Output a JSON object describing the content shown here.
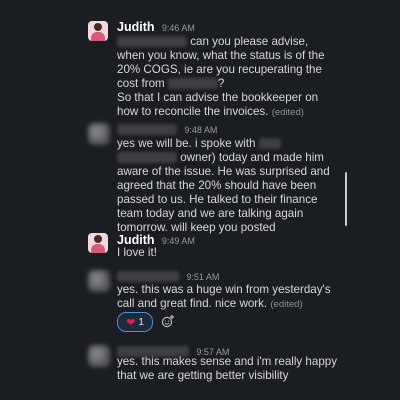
{
  "messages": [
    {
      "author": "Judith",
      "time": "9:46 AM",
      "lines": [
        "can you please advise,",
        "when you know, what the status is of the",
        "20% COGS, ie are you recuperating the",
        "cost from",
        "?",
        "So that I can advise the bookkeeper on",
        "how to reconcile the invoices."
      ],
      "edited": "(edited)"
    },
    {
      "author": "",
      "time": "9:48 AM",
      "lines": [
        "yes we will be. i spoke with",
        "owner) today and made him",
        "aware of the issue. He was surprised and",
        "agreed that the 20% should have been",
        "passed to us. He talked to their finance",
        "team today and we are talking again",
        "tomorrow. will keep you posted"
      ]
    },
    {
      "author": "Judith",
      "time": "9:49 AM",
      "lines": [
        "I love it!"
      ]
    },
    {
      "author": "",
      "time": "9:51 AM",
      "lines": [
        "yes. this was a huge win from yesterday's",
        "call and great find. nice work."
      ],
      "edited": "(edited)",
      "reaction": {
        "emoji": "heart-icon",
        "count": "1"
      }
    },
    {
      "author": "",
      "time": "9:57 AM",
      "lines": [
        "yes. this makes sense and i'm really happy",
        "that we are getting better visibility"
      ]
    }
  ]
}
